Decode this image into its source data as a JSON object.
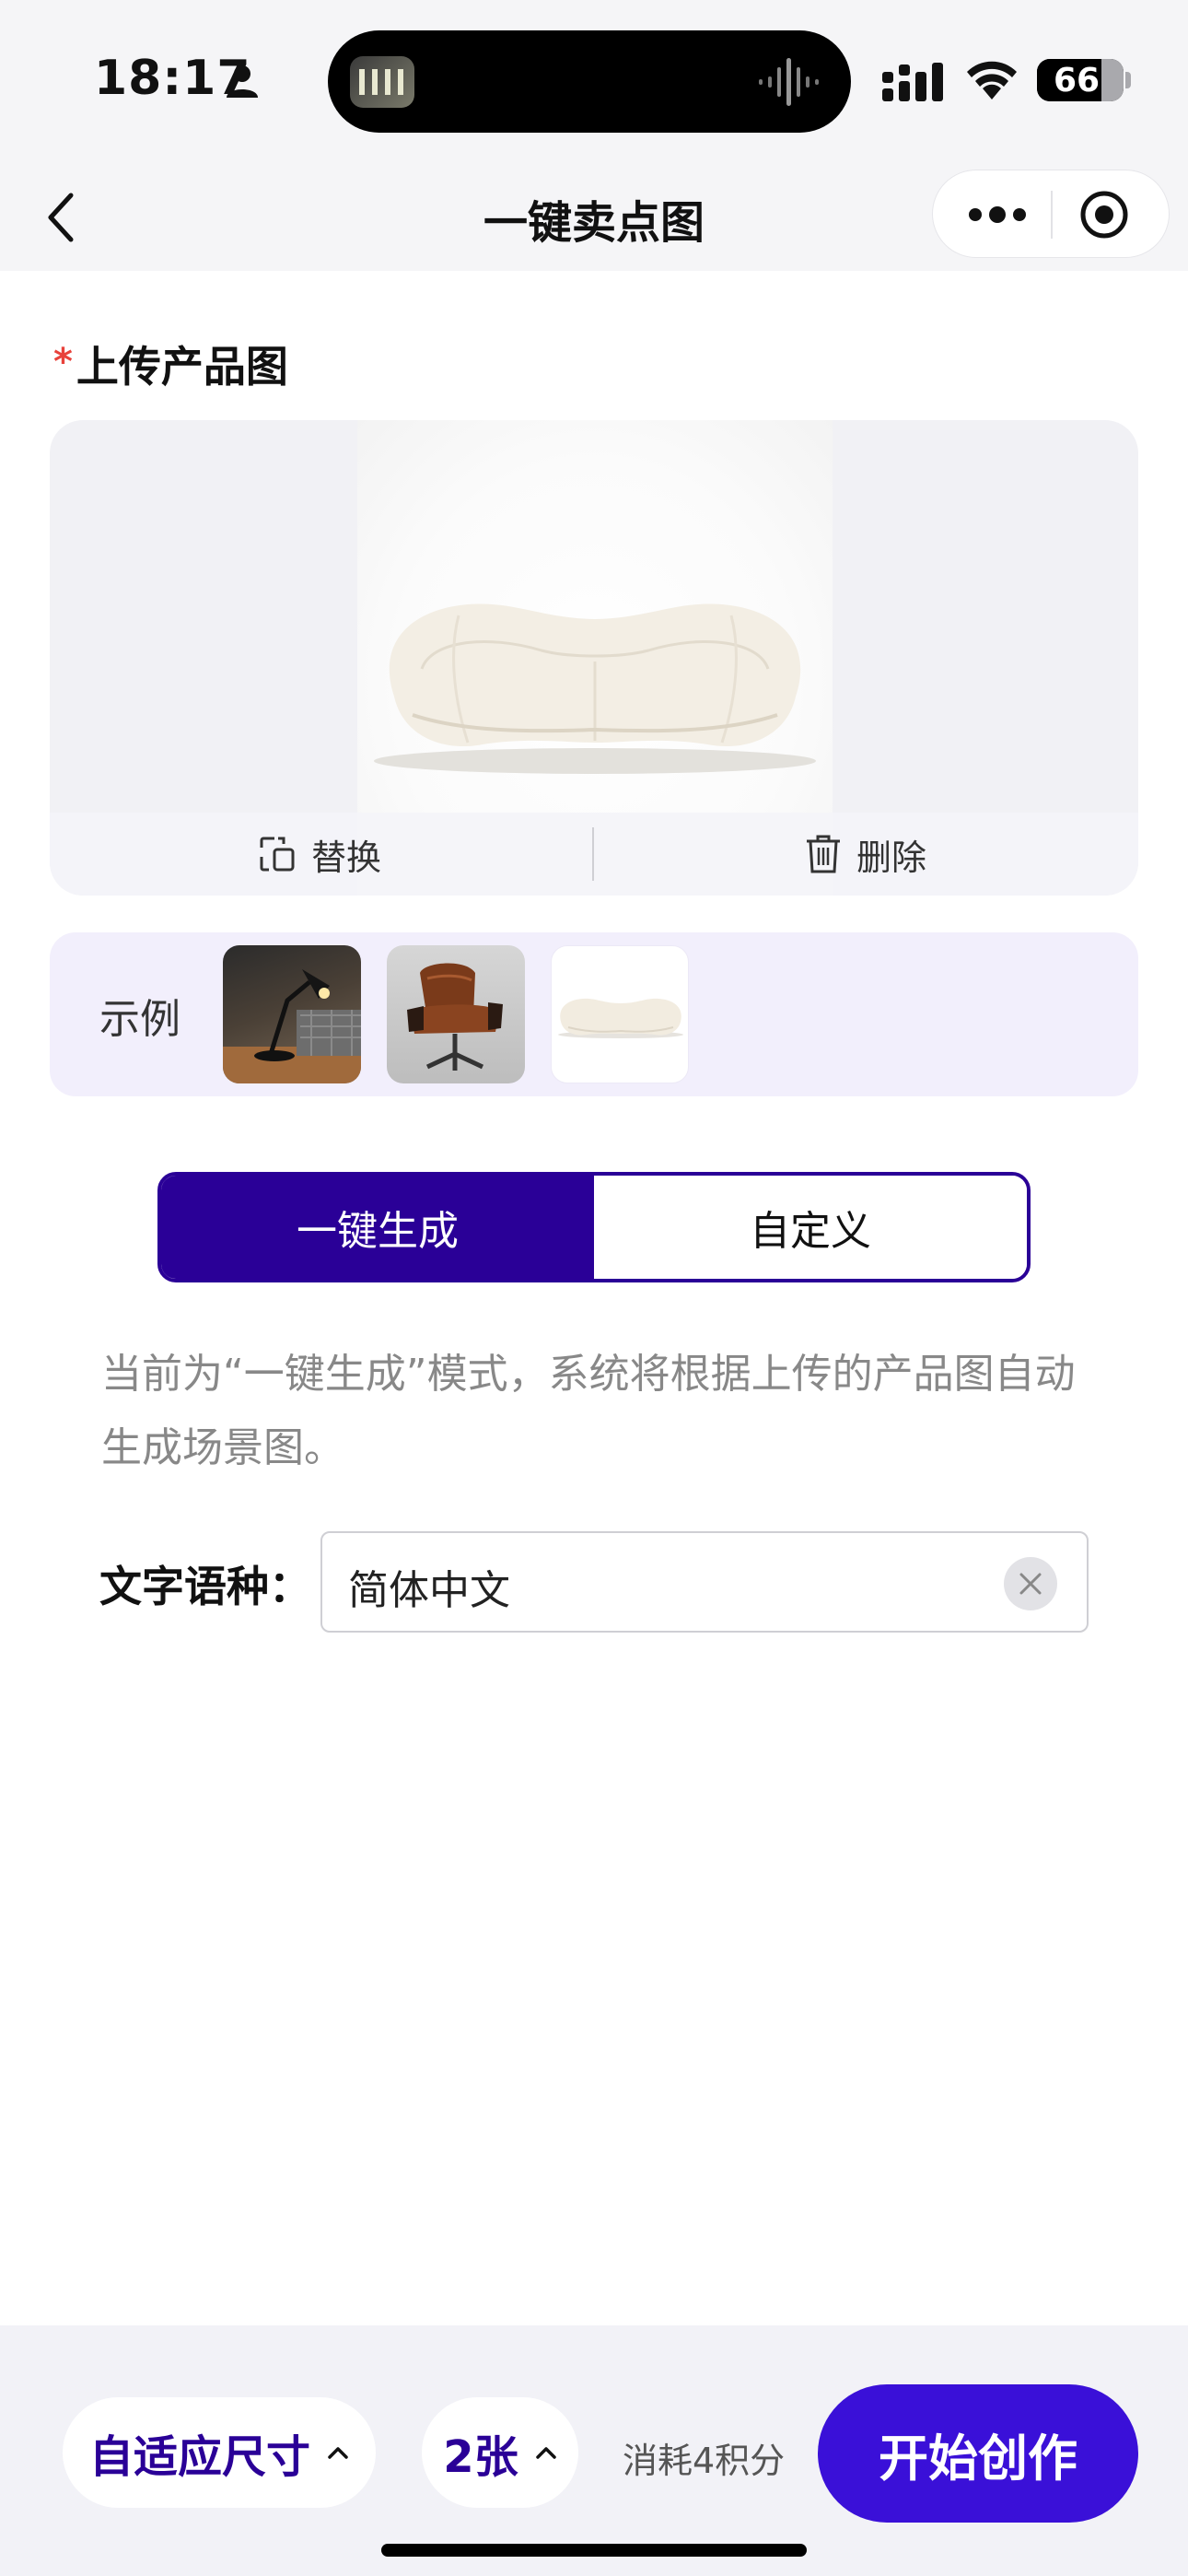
{
  "status_bar": {
    "time": "18:17",
    "battery": "66"
  },
  "nav": {
    "title": "一键卖点图"
  },
  "upload": {
    "required_mark": "*",
    "label": "上传产品图",
    "replace_label": "替换",
    "delete_label": "删除"
  },
  "examples": {
    "label": "示例",
    "items": [
      "desk-lamp-example",
      "leather-lounge-chair-example",
      "white-sofa-example"
    ]
  },
  "mode": {
    "auto_label": "一键生成",
    "custom_label": "自定义",
    "selected": "auto"
  },
  "description": "当前为“一键生成”模式，系统将根据上传的产品图自动生成场景图。",
  "language": {
    "label": "文字语种：",
    "value": "简体中文"
  },
  "bottom": {
    "size_label": "自适应尺寸",
    "count_label": "2张",
    "cost_label": "消耗4积分",
    "start_label": "开始创作"
  },
  "colors": {
    "accent": "#2a0097",
    "button": "#3a10d8",
    "required": "#e8423b",
    "examples_bg": "#f2effc"
  }
}
